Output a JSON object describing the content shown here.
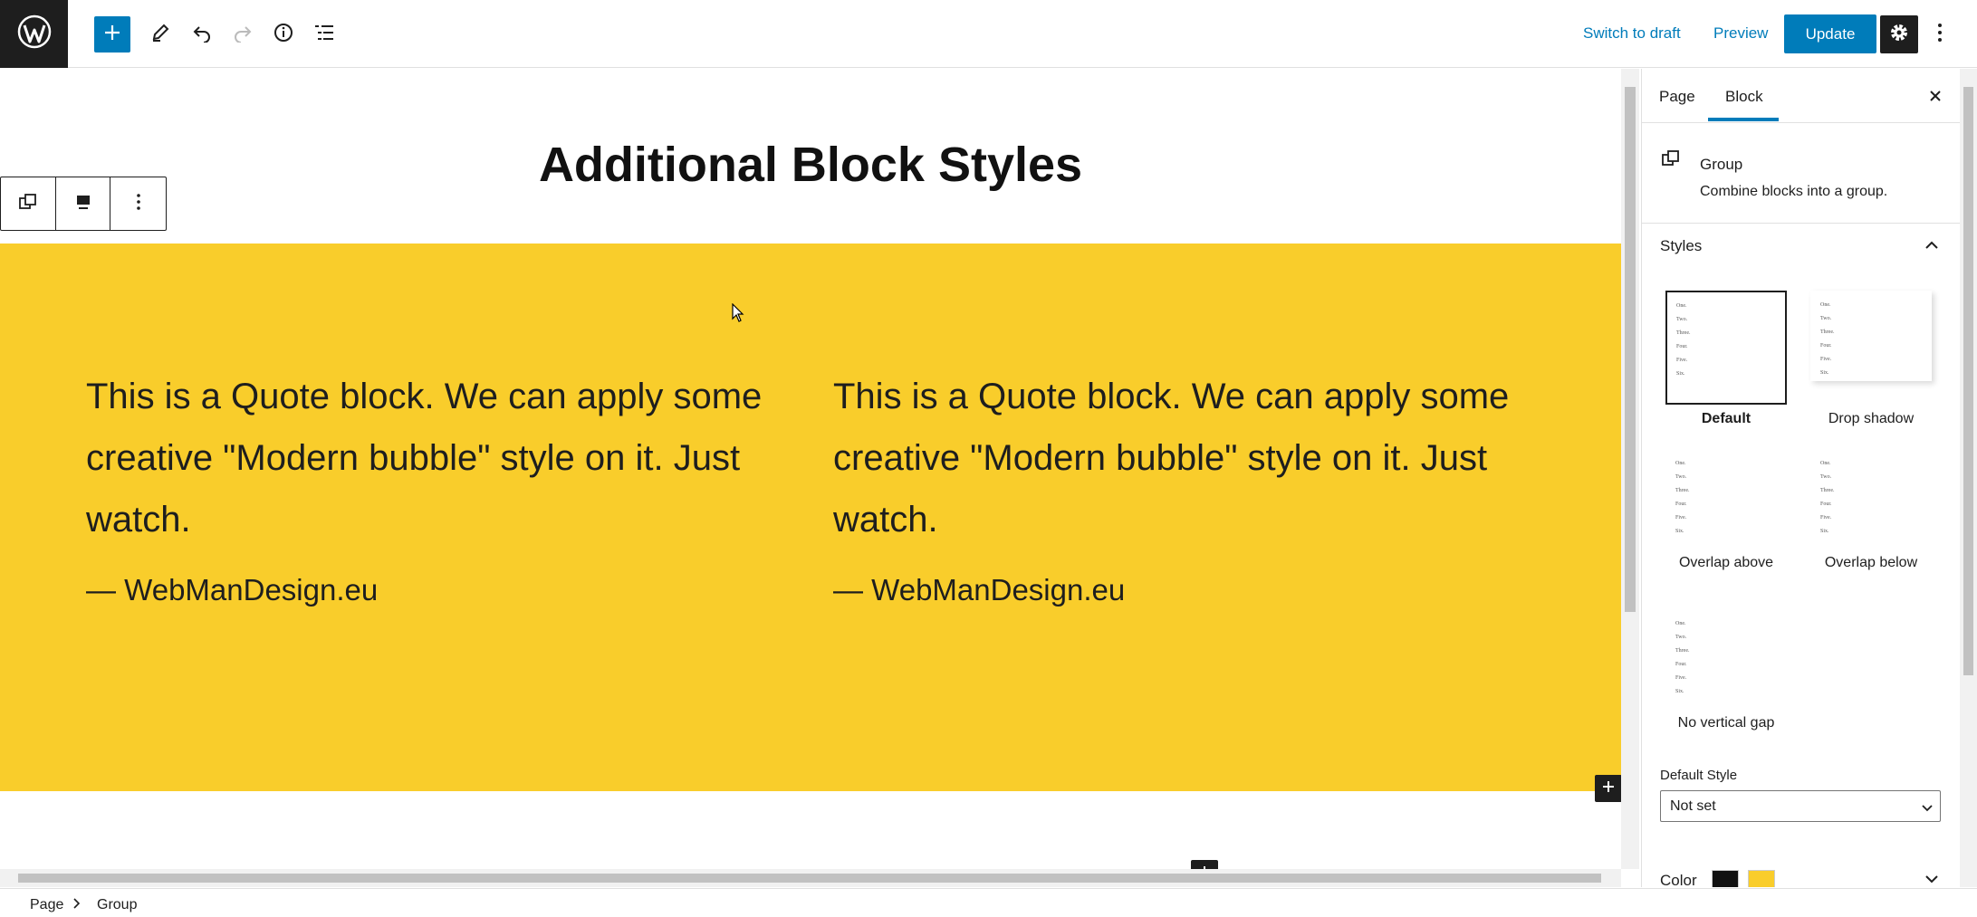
{
  "header": {
    "switch_to_draft": "Switch to draft",
    "preview": "Preview",
    "update": "Update"
  },
  "canvas": {
    "title": "Additional Block Styles",
    "quotes": [
      {
        "text": "This is a Quote block. We can apply some creative \"Modern bubble\" style on it. Just watch.",
        "citation": "— WebManDesign.eu"
      },
      {
        "text": "This is a Quote block. We can apply some creative \"Modern bubble\" style on it. Just watch.",
        "citation": "— WebManDesign.eu"
      }
    ],
    "group_background": "#f9cd2b"
  },
  "sidebar": {
    "tabs": {
      "page": "Page",
      "block": "Block"
    },
    "block_card": {
      "title": "Group",
      "description": "Combine blocks into a group."
    },
    "styles": {
      "heading": "Styles",
      "variations": [
        {
          "label": "Default",
          "active": true
        },
        {
          "label": "Drop shadow",
          "active": false
        },
        {
          "label": "Overlap above",
          "active": false
        },
        {
          "label": "Overlap below",
          "active": false
        },
        {
          "label": "No vertical gap",
          "active": false
        }
      ],
      "preview_lines": [
        "One.",
        "Two.",
        "Three.",
        "Four.",
        "Five.",
        "Six."
      ]
    },
    "default_style": {
      "label": "Default Style",
      "value": "Not set"
    },
    "color": {
      "label": "Color",
      "text_color": "#111111",
      "background_color": "#f9cd2b"
    }
  },
  "breadcrumb": {
    "items": [
      "Page",
      "Group"
    ]
  },
  "colors": {
    "accent": "#007cba",
    "dark": "#1e1e1e"
  },
  "icons": [
    "wordpress-icon",
    "plus-icon",
    "pencil-icon",
    "undo-icon",
    "redo-icon",
    "info-icon",
    "list-view-icon",
    "gear-icon",
    "more-vertical-icon",
    "group-icon",
    "align-icon",
    "close-icon",
    "chevron-up-icon",
    "chevron-down-icon",
    "chevron-right-icon"
  ]
}
